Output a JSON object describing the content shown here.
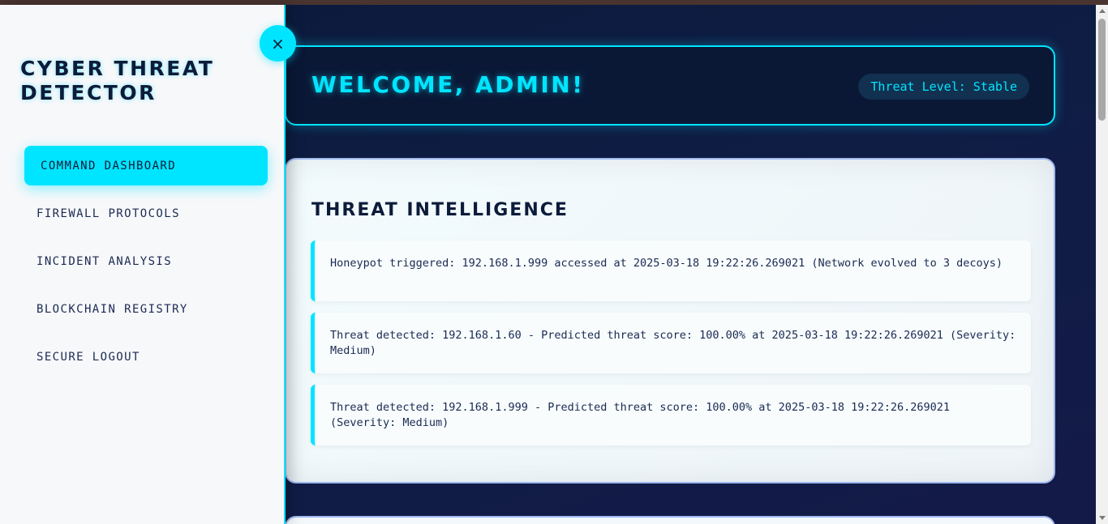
{
  "sidebar": {
    "brand": "CYBER THREAT DETECTOR",
    "items": [
      {
        "label": "COMMAND DASHBOARD",
        "active": true
      },
      {
        "label": "FIREWALL PROTOCOLS",
        "active": false
      },
      {
        "label": "INCIDENT ANALYSIS",
        "active": false
      },
      {
        "label": "BLOCKCHAIN REGISTRY",
        "active": false
      },
      {
        "label": "SECURE LOGOUT",
        "active": false
      }
    ],
    "close_icon": "×"
  },
  "header": {
    "welcome": "WELCOME, ADMIN!",
    "threat_level": "Threat Level: Stable"
  },
  "intel": {
    "title": "THREAT INTELLIGENCE",
    "alerts": [
      {
        "text": "Honeypot triggered: 192.168.1.999 accessed at 2025-03-18 19:22:26.269021 (Network evolved to 3 decoys)"
      },
      {
        "text": "Threat detected: 192.168.1.60 - Predicted threat score: 100.00% at 2025-03-18 19:22:26.269021 (Severity: Medium)"
      },
      {
        "text": "Threat detected: 192.168.1.999 - Predicted threat score: 100.00% at 2025-03-18 19:22:26.269021 (Severity: Medium)"
      }
    ]
  },
  "colors": {
    "accent": "#00e5ff",
    "background": "#0b1a3a",
    "sidebar_bg": "#f7f8fa",
    "text_dark": "#0d1b3a"
  },
  "icons": {
    "close": "close-icon"
  }
}
